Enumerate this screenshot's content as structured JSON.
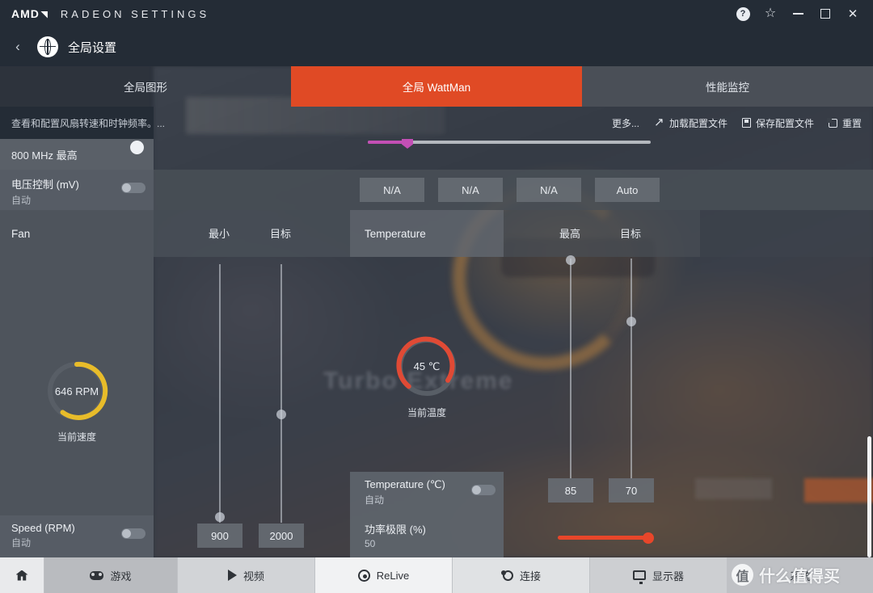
{
  "titlebar": {
    "brand": "AMD",
    "app_title": "RADEON SETTINGS",
    "help_glyph": "?",
    "favorite_glyph": "☆",
    "close_glyph": "✕"
  },
  "breadcrumb": {
    "back_glyph": "‹",
    "label": "全局设置"
  },
  "tabs": [
    {
      "label": "全局图形",
      "active": false
    },
    {
      "label": "全局 WattMan",
      "active": true
    },
    {
      "label": "性能监控",
      "active": false
    }
  ],
  "toolbar": {
    "description": "查看和配置风扇转速和时钟频率。...",
    "more_label": "更多...",
    "load_label": "加载配置文件",
    "save_label": "保存配置文件",
    "reset_label": "重置"
  },
  "main": {
    "clock_row_label": "800 MHz 最高",
    "voltage": {
      "label": "电压控制 (mV)",
      "value": "自动"
    },
    "na_boxes": [
      "N/A",
      "N/A",
      "N/A",
      "Auto"
    ],
    "headers": {
      "fan": "Fan",
      "min": "最小",
      "target_left": "目标",
      "temperature": "Temperature",
      "max": "最高",
      "target_right": "目标"
    },
    "fan_gauge": {
      "value": "646 RPM",
      "caption": "当前速度"
    },
    "temp_gauge": {
      "value": "45 ℃",
      "caption": "当前温度"
    },
    "speed": {
      "label": "Speed (RPM)",
      "value": "自动",
      "min_box": "900",
      "target_box": "2000"
    },
    "temperature": {
      "label": "Temperature (℃)",
      "value": "自动",
      "max_box": "85",
      "target_box": "70"
    },
    "power_limit": {
      "label": "功率极限 (%)",
      "value": "50"
    }
  },
  "bottomnav": [
    {
      "label": "",
      "icon": "home-icon"
    },
    {
      "label": "游戏",
      "icon": "gamepad-icon"
    },
    {
      "label": "视频",
      "icon": "play-icon"
    },
    {
      "label": "ReLive",
      "icon": "relive-icon"
    },
    {
      "label": "连接",
      "icon": "connect-icon"
    },
    {
      "label": "显示器",
      "icon": "monitor-icon"
    },
    {
      "label": "系统",
      "icon": "system-icon"
    }
  ],
  "watermark": {
    "badge": "值",
    "text": "什么值得买"
  },
  "colors": {
    "accent_orange": "#e04a25",
    "fan_gauge": "#e8bc2a",
    "temp_gauge": "#e04a35",
    "slider_purple": "#c34fb5",
    "slider_red": "#e8462a"
  }
}
